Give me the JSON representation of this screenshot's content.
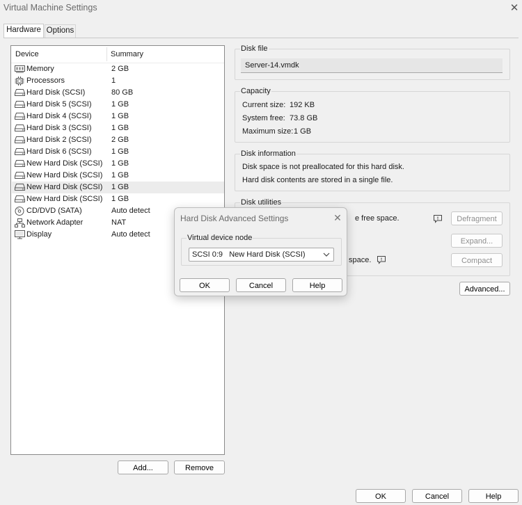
{
  "window": {
    "title": "Virtual Machine Settings",
    "close_glyph": "✕"
  },
  "tabs": [
    {
      "label": "Hardware"
    },
    {
      "label": "Options"
    }
  ],
  "device_list": {
    "col_device": "Device",
    "col_summary": "Summary",
    "rows": [
      {
        "name": "Memory",
        "summary": "2 GB",
        "icon": "memory-icon"
      },
      {
        "name": "Processors",
        "summary": "1",
        "icon": "processor-icon"
      },
      {
        "name": "Hard Disk (SCSI)",
        "summary": "80 GB",
        "icon": "hard-disk-icon"
      },
      {
        "name": "Hard Disk 5 (SCSI)",
        "summary": "1 GB",
        "icon": "hard-disk-icon"
      },
      {
        "name": "Hard Disk 4 (SCSI)",
        "summary": "1 GB",
        "icon": "hard-disk-icon"
      },
      {
        "name": "Hard Disk 3 (SCSI)",
        "summary": "1 GB",
        "icon": "hard-disk-icon"
      },
      {
        "name": "Hard Disk 2 (SCSI)",
        "summary": "2 GB",
        "icon": "hard-disk-icon"
      },
      {
        "name": "Hard Disk 6 (SCSI)",
        "summary": "1 GB",
        "icon": "hard-disk-icon"
      },
      {
        "name": "New Hard Disk (SCSI)",
        "summary": "1 GB",
        "icon": "hard-disk-icon"
      },
      {
        "name": "New Hard Disk (SCSI)",
        "summary": "1 GB",
        "icon": "hard-disk-icon"
      },
      {
        "name": "New Hard Disk (SCSI)",
        "summary": "1 GB",
        "icon": "hard-disk-icon",
        "selected": true
      },
      {
        "name": "New Hard Disk (SCSI)",
        "summary": "1 GB",
        "icon": "hard-disk-icon"
      },
      {
        "name": "CD/DVD (SATA)",
        "summary": "Auto detect",
        "icon": "cd-dvd-icon"
      },
      {
        "name": "Network Adapter",
        "summary": "NAT",
        "icon": "network-adapter-icon"
      },
      {
        "name": "Display",
        "summary": "Auto detect",
        "icon": "display-icon"
      }
    ],
    "add_button": "Add...",
    "remove_button": "Remove"
  },
  "disk_file": {
    "label": "Disk file",
    "value": "Server-14.vmdk"
  },
  "capacity": {
    "label": "Capacity",
    "current_size_label": "Current size:",
    "current_size": "192 KB",
    "system_free_label": "System free:",
    "system_free": "73.8 GB",
    "maximum_size_label": "Maximum size:",
    "maximum_size": "1 GB"
  },
  "disk_information": {
    "label": "Disk information",
    "line1": "Disk space is not preallocated for this hard disk.",
    "line2": "Hard disk contents are stored in a single file."
  },
  "disk_utilities": {
    "label": "Disk utilities",
    "partial_text_1": "e free space.",
    "partial_text_2": "space.",
    "defragment_button": "Defragment",
    "expand_button": "Expand...",
    "compact_button": "Compact"
  },
  "advanced_button": "Advanced...",
  "footer": {
    "ok": "OK",
    "cancel": "Cancel",
    "help": "Help"
  },
  "advanced_dialog": {
    "title": "Hard Disk Advanced Settings",
    "close_glyph": "✕",
    "node_label": "Virtual device node",
    "node_value": "SCSI 0:9   New Hard Disk (SCSI)",
    "ok": "OK",
    "cancel": "Cancel",
    "help": "Help"
  }
}
